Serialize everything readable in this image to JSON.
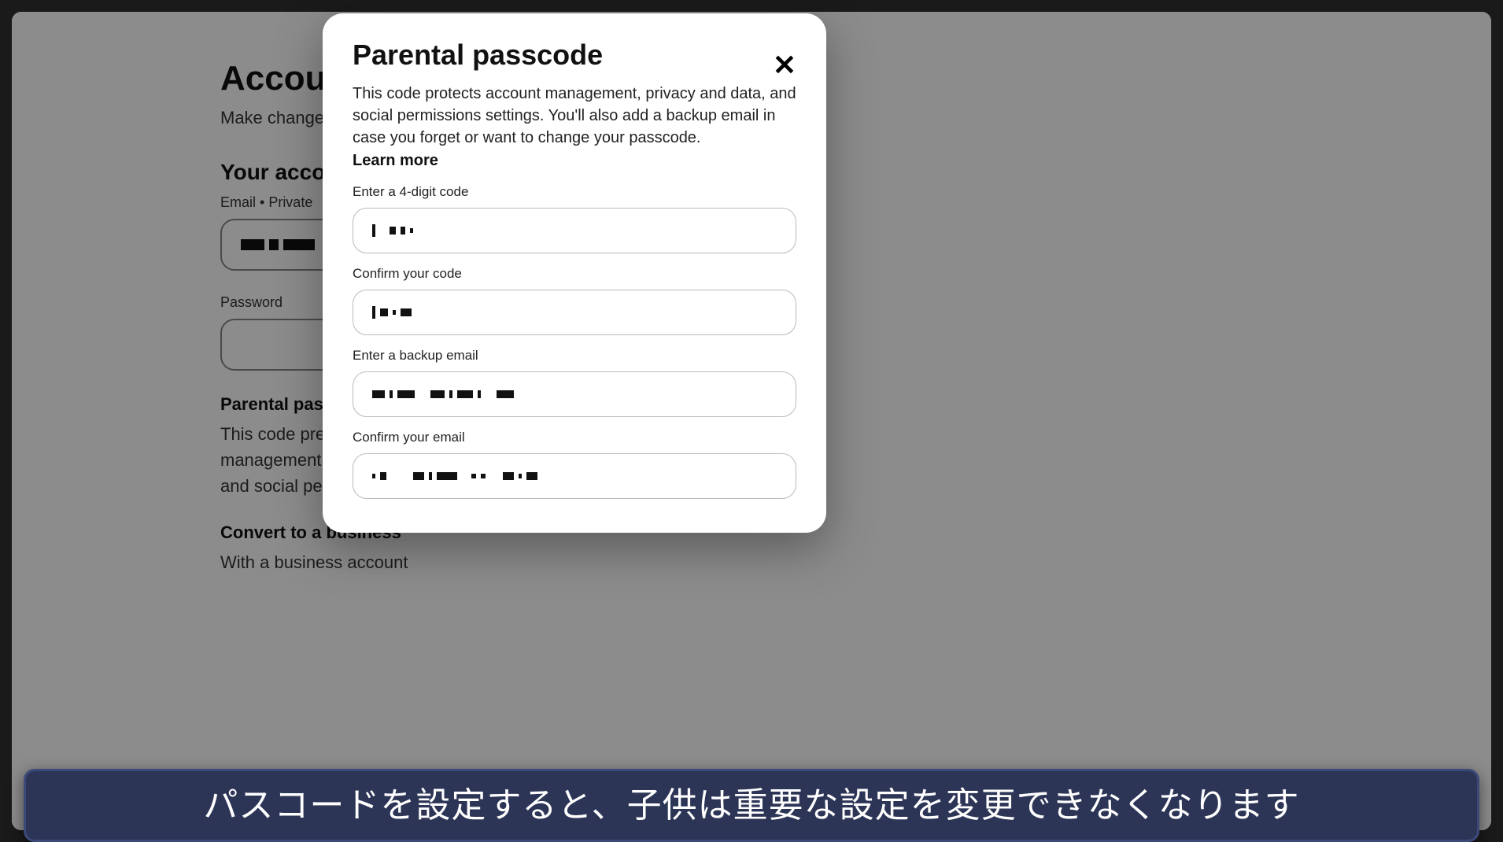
{
  "background": {
    "title": "Account management",
    "subtitle": "Make changes to",
    "section_your_account": "Your account",
    "email_label": "Email • Private",
    "password_label": "Password",
    "parental_heading": "Parental passcode",
    "parental_desc_l1": "This code prevents",
    "parental_desc_l2": "management, privacy",
    "parental_desc_l3": "and social permissions",
    "convert_heading": "Convert to a business",
    "convert_desc": "With a business account"
  },
  "modal": {
    "title": "Parental passcode",
    "description": "This code protects account management, privacy and data, and social permissions settings. You'll also add a backup email in case you forget or want to change your passcode.",
    "learn_more": "Learn more",
    "fields": {
      "code_label": "Enter a 4-digit code",
      "confirm_code_label": "Confirm your code",
      "backup_email_label": "Enter a backup email",
      "confirm_email_label": "Confirm your email"
    }
  },
  "banner": {
    "text": "パスコードを設定すると、子供は重要な設定を変更できなくなります"
  }
}
